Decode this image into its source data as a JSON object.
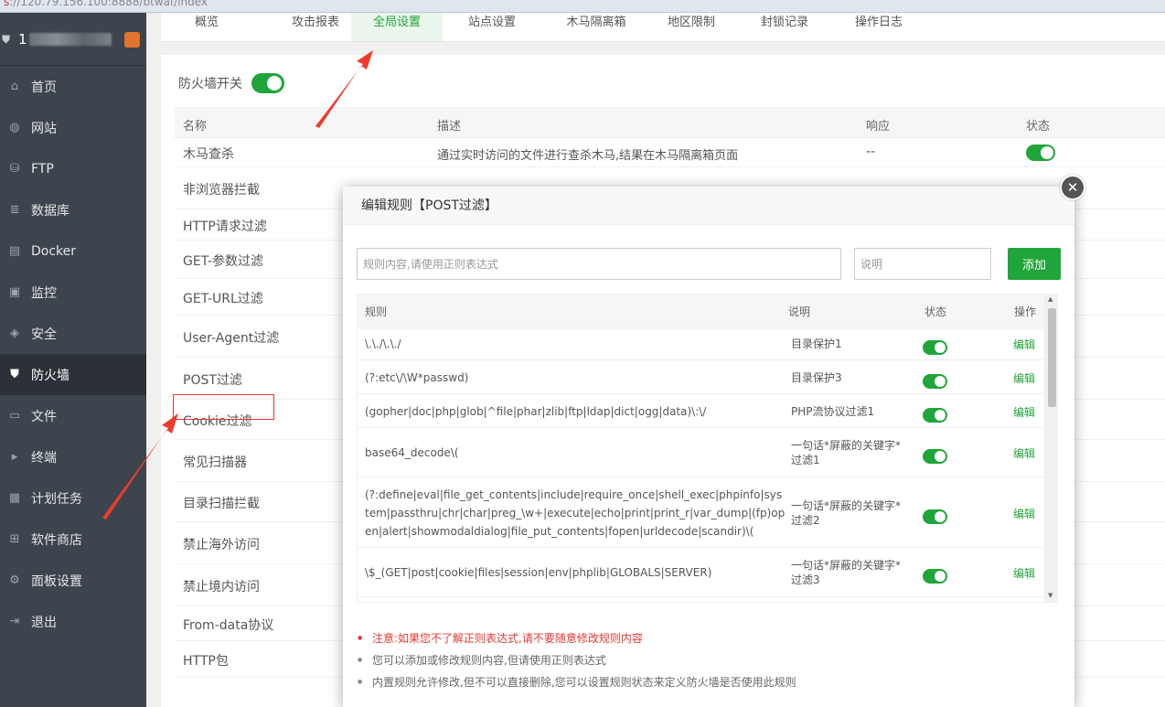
{
  "browser": {
    "url_prefix": "s",
    "url": "://120.79.156.100:8888/btwaf/index"
  },
  "sidebar": {
    "user_initial": "1",
    "items": [
      {
        "label": "首页",
        "icon": "home-icon",
        "glyph": "⌂"
      },
      {
        "label": "网站",
        "icon": "globe-icon",
        "glyph": "◍"
      },
      {
        "label": "FTP",
        "icon": "ftp-icon",
        "glyph": "⛁"
      },
      {
        "label": "数据库",
        "icon": "database-icon",
        "glyph": "≣"
      },
      {
        "label": "Docker",
        "icon": "docker-icon",
        "glyph": "▤"
      },
      {
        "label": "监控",
        "icon": "monitor-icon",
        "glyph": "▣"
      },
      {
        "label": "安全",
        "icon": "security-icon",
        "glyph": "◈"
      },
      {
        "label": "防火墙",
        "icon": "firewall-icon",
        "glyph": "⛊"
      },
      {
        "label": "文件",
        "icon": "folder-icon",
        "glyph": "▭"
      },
      {
        "label": "终端",
        "icon": "terminal-icon",
        "glyph": "▸"
      },
      {
        "label": "计划任务",
        "icon": "calendar-icon",
        "glyph": "▦"
      },
      {
        "label": "软件商店",
        "icon": "apps-icon",
        "glyph": "⊞"
      },
      {
        "label": "面板设置",
        "icon": "gear-icon",
        "glyph": "⚙"
      },
      {
        "label": "退出",
        "icon": "logout-icon",
        "glyph": "⇥"
      }
    ],
    "active_index": 7
  },
  "tabs": [
    "概览",
    "攻击报表",
    "全局设置",
    "站点设置",
    "木马隔离箱",
    "地区限制",
    "封锁记录",
    "操作日志"
  ],
  "active_tab": 2,
  "firewall": {
    "switch_label": "防火墙开关",
    "columns": {
      "name": "名称",
      "desc": "描述",
      "resp": "响应",
      "status": "状态"
    },
    "rows": [
      {
        "name": "木马查杀",
        "desc": "通过实时访问的文件进行查杀木马,结果在木马隔离箱页面",
        "resp": "--"
      },
      {
        "name": "非浏览器拦截"
      },
      {
        "name": "HTTP请求过滤"
      },
      {
        "name": "GET-参数过滤"
      },
      {
        "name": "GET-URL过滤"
      },
      {
        "name": "User-Agent过滤"
      },
      {
        "name": "POST过滤"
      },
      {
        "name": "Cookie过滤"
      },
      {
        "name": "常见扫描器"
      },
      {
        "name": "目录扫描拦截"
      },
      {
        "name": "禁止海外访问"
      },
      {
        "name": "禁止境内访问"
      },
      {
        "name": "From-data协议"
      },
      {
        "name": "HTTP包"
      }
    ]
  },
  "modal": {
    "title": "编辑规则【POST过滤】",
    "rule_placeholder": "规则内容,请使用正则表达式",
    "desc_placeholder": "说明",
    "add_label": "添加",
    "columns": {
      "rule": "规则",
      "desc": "说明",
      "status": "状态",
      "action": "操作"
    },
    "edit_label": "编辑",
    "rules": [
      {
        "rule": "\\.\\./\\.\\./",
        "desc": "目录保护1",
        "enabled": true
      },
      {
        "rule": "(?:etc\\/\\W*passwd)",
        "desc": "目录保护3",
        "enabled": true
      },
      {
        "rule": "(gopher|doc|php|glob|^file|phar|zlib|ftp|ldap|dict|ogg|data)\\:\\/",
        "desc": "PHP流协议过滤1",
        "enabled": true
      },
      {
        "rule": "base64_decode\\(",
        "desc": "一句话*屏蔽的关键字*过滤1",
        "enabled": true
      },
      {
        "rule": "(?:define|eval|file_get_contents|include|require_once|shell_exec|phpinfo|system|passthru|chr|char|preg_\\w+|execute|echo|print|print_r|var_dump|(fp)open|alert|showmodaldialog|file_put_contents|fopen|urldecode|scandir)\\(",
        "desc": "一句话*屏蔽的关键字*过滤2",
        "enabled": true
      },
      {
        "rule": "\\$_(GET|post|cookie|files|session|env|phplib|GLOBALS|SERVER)",
        "desc": "一句话*屏蔽的关键字*过滤3",
        "enabled": true
      }
    ],
    "notes": [
      "注意:如果您不了解正则表达式,请不要随意修改规则内容",
      "您可以添加或修改规则内容,但请使用正则表达式",
      "内置规则允许修改,但不可以直接删除,您可以设置规则状态来定义防火墙是否使用此规则"
    ]
  },
  "colors": {
    "accent": "#20a53a",
    "sidebar": "#3c444d",
    "warning": "#e53935"
  }
}
